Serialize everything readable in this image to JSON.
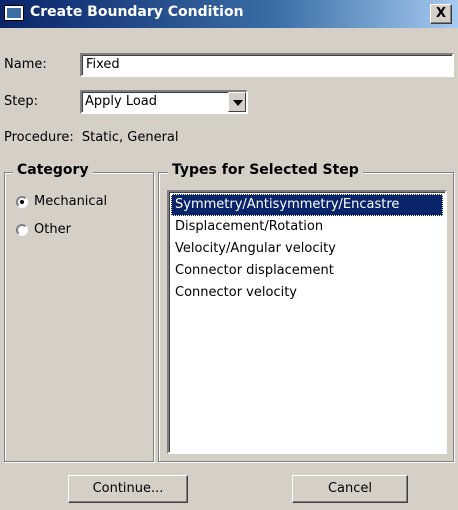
{
  "window": {
    "title": "Create Boundary Condition",
    "close_glyph": "X",
    "icon": "window-icon"
  },
  "name": {
    "label": "Name:",
    "value": "Fixed"
  },
  "step": {
    "label": "Step:",
    "selected": "Apply Load"
  },
  "procedure": {
    "label": "Procedure:",
    "value": "Static, General"
  },
  "category": {
    "title": "Category",
    "options": [
      {
        "label": "Mechanical",
        "checked": true
      },
      {
        "label": "Other",
        "checked": false
      }
    ]
  },
  "types": {
    "title": "Types for Selected Step",
    "items": [
      {
        "label": "Symmetry/Antisymmetry/Encastre",
        "selected": true
      },
      {
        "label": "Displacement/Rotation",
        "selected": false
      },
      {
        "label": "Velocity/Angular velocity",
        "selected": false
      },
      {
        "label": "Connector displacement",
        "selected": false
      },
      {
        "label": "Connector velocity",
        "selected": false
      }
    ]
  },
  "buttons": {
    "continue_label": "Continue...",
    "cancel_label": "Cancel"
  },
  "colors": {
    "selection": "#0a246a",
    "dialog_bg": "#d4d0c8",
    "title_bar": "#0a246a"
  }
}
